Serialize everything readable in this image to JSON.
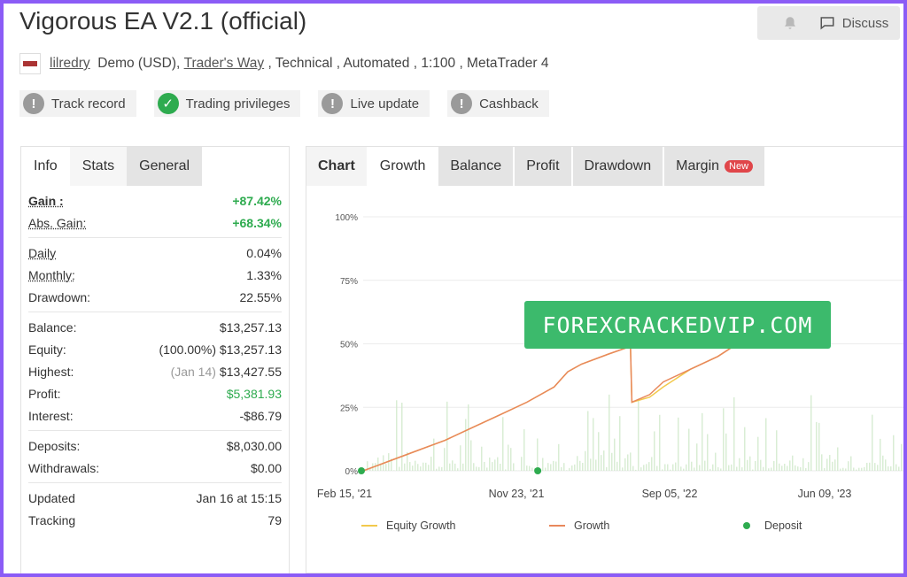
{
  "header": {
    "title": "Vigorous EA V2.1 (official)",
    "discuss_label": "Discuss"
  },
  "meta": {
    "user": "lilredry",
    "account_type": "Demo (USD),",
    "broker": "Trader's Way",
    "details": " , Technical , Automated , 1:100 , MetaTrader 4"
  },
  "badges": [
    {
      "label": "Track record",
      "status": "info"
    },
    {
      "label": "Trading privileges",
      "status": "ok"
    },
    {
      "label": "Live update",
      "status": "info"
    },
    {
      "label": "Cashback",
      "status": "info"
    }
  ],
  "left_tabs": [
    {
      "label": "Info"
    },
    {
      "label": "Stats"
    },
    {
      "label": "General"
    }
  ],
  "stats": {
    "gain_label": "Gain :",
    "gain_value": "+87.42%",
    "abs_gain_label": "Abs. Gain:",
    "abs_gain_value": "+68.34%",
    "daily_label": "Daily",
    "daily_value": "0.04%",
    "monthly_label": "Monthly:",
    "monthly_value": "1.33%",
    "drawdown_label": "Drawdown:",
    "drawdown_value": "22.55%",
    "balance_label": "Balance:",
    "balance_value": "$13,257.13",
    "equity_label": "Equity:",
    "equity_pct": "(100.00%)",
    "equity_value": "$13,257.13",
    "highest_label": "Highest:",
    "highest_date": "(Jan 14)",
    "highest_value": "$13,427.55",
    "profit_label": "Profit:",
    "profit_value": "$5,381.93",
    "interest_label": "Interest:",
    "interest_value": "-$86.79",
    "deposits_label": "Deposits:",
    "deposits_value": "$8,030.00",
    "withdrawals_label": "Withdrawals:",
    "withdrawals_value": "$0.00",
    "updated_label": "Updated",
    "updated_value": "Jan 16 at 15:15",
    "tracking_label": "Tracking",
    "tracking_value": "79"
  },
  "right_tabs": [
    {
      "label": "Chart"
    },
    {
      "label": "Growth"
    },
    {
      "label": "Balance"
    },
    {
      "label": "Profit"
    },
    {
      "label": "Drawdown"
    },
    {
      "label": "Margin"
    }
  ],
  "new_badge": "New",
  "watermark": "FOREXCRACKEDVIP.COM",
  "colors": {
    "accent_green": "#2eab4f",
    "growth_line": "#e8885c",
    "equity_line": "#f2c94c",
    "deposit_dot": "#2eab4f",
    "volume_bars": "#cfe8c9"
  },
  "chart_data": {
    "type": "line",
    "x_tick_labels": [
      "Feb 15, '21",
      "Nov 23, '21",
      "Sep 05, '22",
      "Jun 09, '23"
    ],
    "y_tick_labels": [
      "100%",
      "75%",
      "50%",
      "25%",
      "0%"
    ],
    "ylim": [
      0,
      100
    ],
    "legend": [
      "Equity Growth",
      "Growth",
      "Deposit"
    ],
    "series": [
      {
        "name": "Growth",
        "points": [
          [
            0,
            0
          ],
          [
            0.05,
            2
          ],
          [
            0.1,
            4
          ],
          [
            0.2,
            8
          ],
          [
            0.3,
            12
          ],
          [
            0.4,
            17
          ],
          [
            0.5,
            22
          ],
          [
            0.6,
            27
          ],
          [
            0.7,
            33
          ],
          [
            0.75,
            39
          ],
          [
            0.8,
            42
          ],
          [
            0.9,
            46
          ],
          [
            0.98,
            49
          ],
          [
            0.985,
            27
          ],
          [
            1.05,
            30
          ],
          [
            1.1,
            35
          ],
          [
            1.2,
            40
          ],
          [
            1.3,
            45
          ],
          [
            1.4,
            52
          ]
        ]
      },
      {
        "name": "Equity Growth",
        "points": [
          [
            0,
            0
          ],
          [
            0.05,
            2
          ],
          [
            0.1,
            4
          ],
          [
            0.2,
            8
          ],
          [
            0.3,
            12
          ],
          [
            0.4,
            17
          ],
          [
            0.5,
            22
          ],
          [
            0.6,
            27
          ],
          [
            0.7,
            33
          ],
          [
            0.75,
            39
          ],
          [
            0.8,
            42
          ],
          [
            0.9,
            46
          ],
          [
            0.98,
            49
          ],
          [
            0.985,
            27
          ],
          [
            1.05,
            29
          ],
          [
            1.1,
            33
          ],
          [
            1.2,
            40
          ],
          [
            1.3,
            45
          ],
          [
            1.4,
            52
          ]
        ]
      }
    ],
    "deposits_x": [
      0,
      0.64
    ]
  }
}
